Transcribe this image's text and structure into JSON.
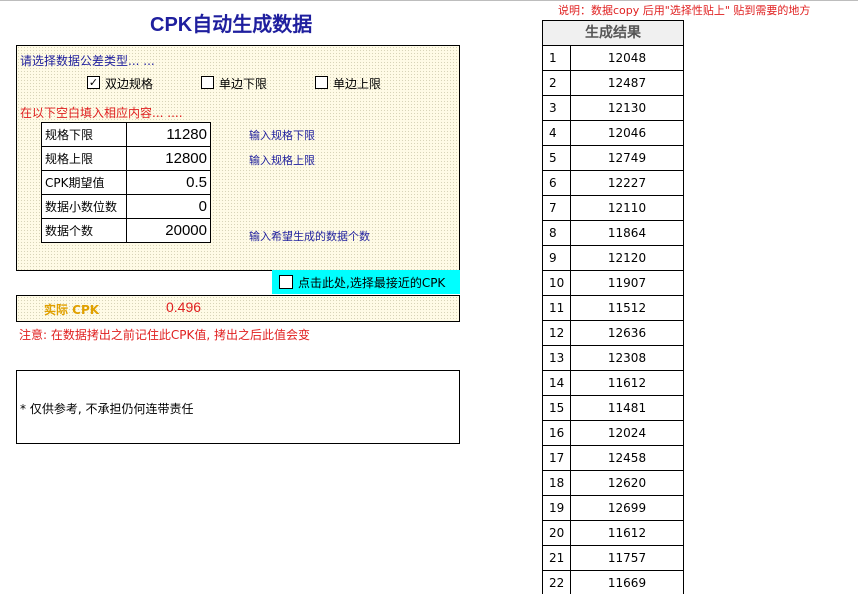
{
  "title": "CPK自动生成数据",
  "top_note": "说明：数据copy 后用\"选择性贴上\" 贴到需要的地方",
  "panel": {
    "prompt_type": "请选择数据公差类型... ...",
    "options": [
      {
        "label": "双边规格",
        "checked": true
      },
      {
        "label": "单边下限",
        "checked": false
      },
      {
        "label": "单边上限",
        "checked": false
      }
    ],
    "prompt_fill": "在以下空白填入相应内容... ....",
    "params": [
      {
        "label": "规格下限",
        "value": "11280",
        "hint": "输入规格下限"
      },
      {
        "label": "规格上限",
        "value": "12800",
        "hint": "输入规格上限"
      },
      {
        "label": "CPK期望值",
        "value": "0.5",
        "hint": ""
      },
      {
        "label": "数据小数位数",
        "value": "0",
        "hint": ""
      },
      {
        "label": "数据个数",
        "value": "20000",
        "hint": "输入希望生成的数据个数"
      }
    ]
  },
  "nearest_option": {
    "label": "点击此处,选择最接近的CPK",
    "checked": false
  },
  "actual_cpk": {
    "label": "实际 CPK",
    "value": "0.496"
  },
  "warning": "注意: 在数据拷出之前记住此CPK值, 拷出之后此值会变",
  "disclaimer": "* 仅供参考, 不承担仍何连带责任",
  "results": {
    "header": "生成结果",
    "rows": [
      {
        "index": "1",
        "value": "12048"
      },
      {
        "index": "2",
        "value": "12487"
      },
      {
        "index": "3",
        "value": "12130"
      },
      {
        "index": "4",
        "value": "12046"
      },
      {
        "index": "5",
        "value": "12749"
      },
      {
        "index": "6",
        "value": "12227"
      },
      {
        "index": "7",
        "value": "12110"
      },
      {
        "index": "8",
        "value": "11864"
      },
      {
        "index": "9",
        "value": "12120"
      },
      {
        "index": "10",
        "value": "11907"
      },
      {
        "index": "11",
        "value": "11512"
      },
      {
        "index": "12",
        "value": "12636"
      },
      {
        "index": "13",
        "value": "12308"
      },
      {
        "index": "14",
        "value": "11612"
      },
      {
        "index": "15",
        "value": "11481"
      },
      {
        "index": "16",
        "value": "12024"
      },
      {
        "index": "17",
        "value": "12458"
      },
      {
        "index": "18",
        "value": "12620"
      },
      {
        "index": "19",
        "value": "12699"
      },
      {
        "index": "20",
        "value": "11612"
      },
      {
        "index": "21",
        "value": "11757"
      },
      {
        "index": "22",
        "value": "11669"
      }
    ]
  },
  "colors": {
    "title": "#1f1f9e",
    "accent_red": "#e02020",
    "cpk_label": "#e0a000",
    "highlight": "#00ffff"
  }
}
